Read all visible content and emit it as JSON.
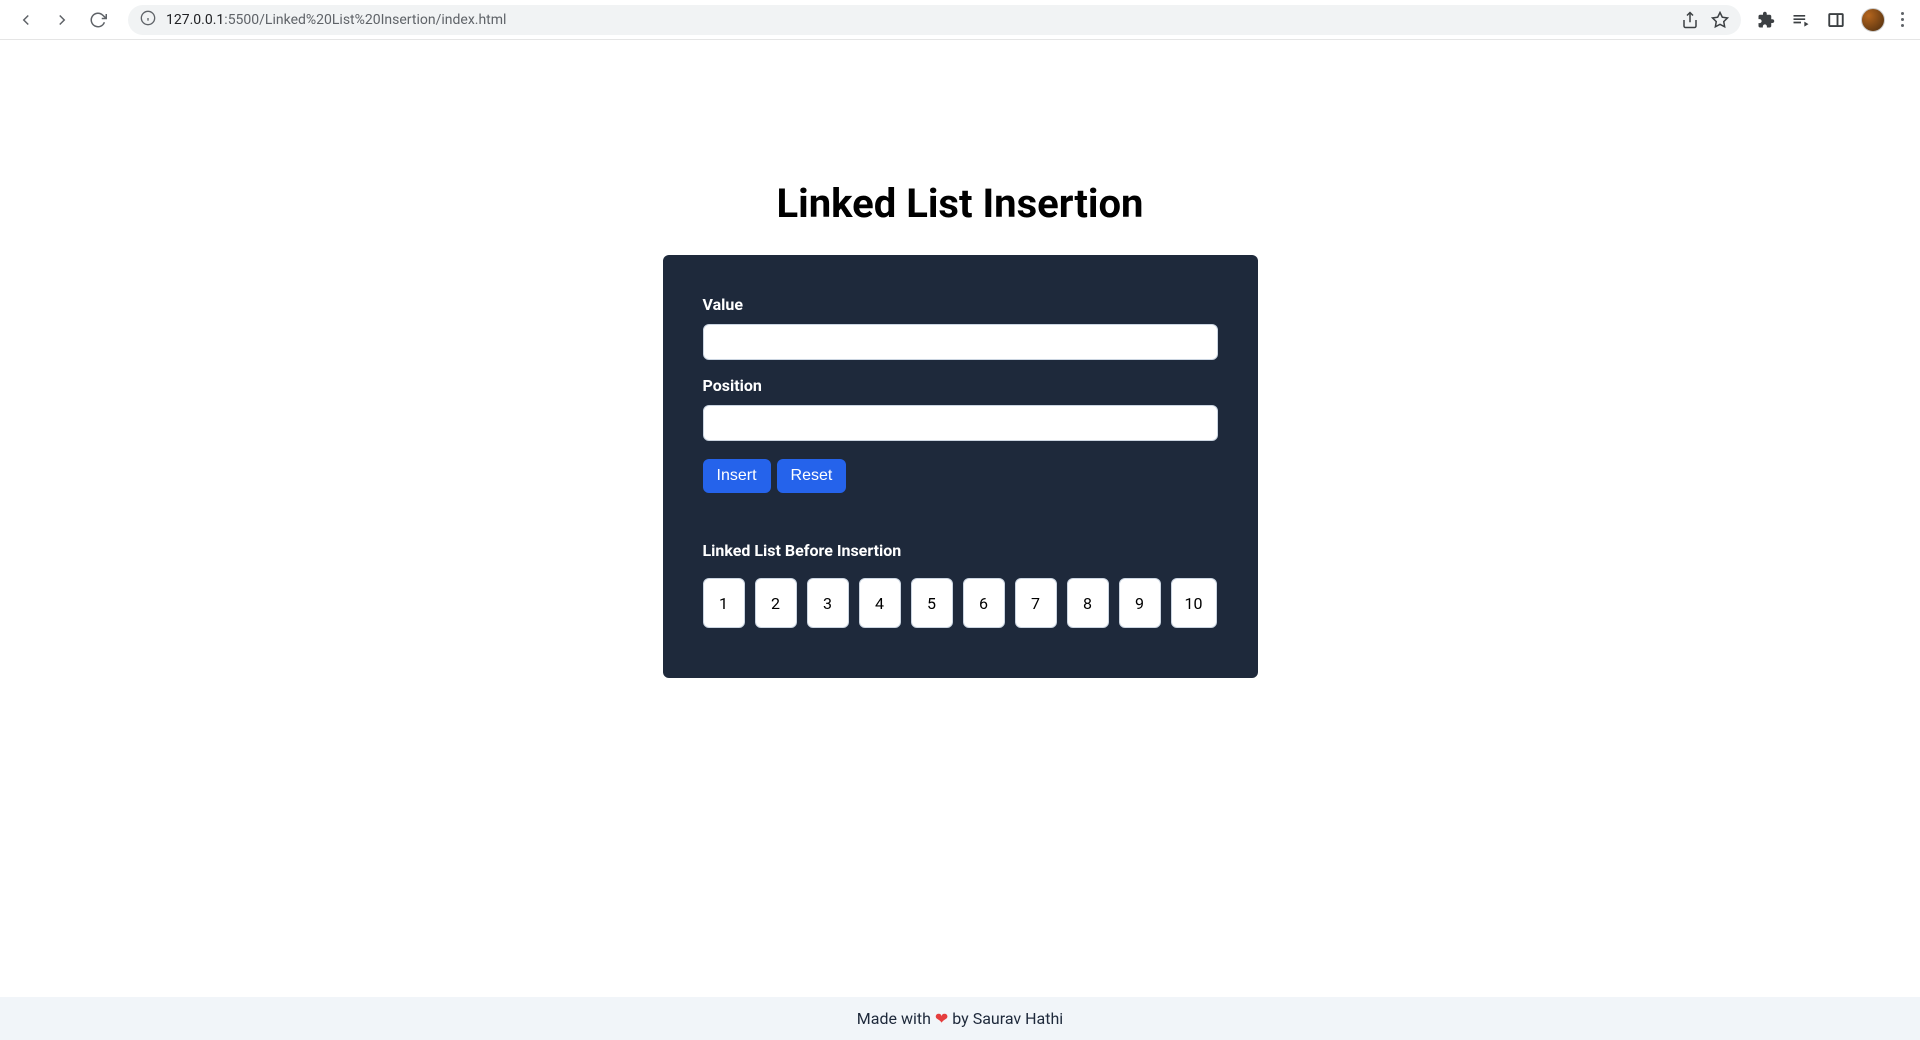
{
  "browser": {
    "url_host": "127.0.0.1",
    "url_port_path": ":5500/Linked%20List%20Insertion/index.html"
  },
  "page": {
    "title": "Linked List Insertion",
    "form": {
      "value_label": "Value",
      "value_input": "",
      "position_label": "Position",
      "position_input": "",
      "insert_button": "Insert",
      "reset_button": "Reset"
    },
    "list_section": {
      "heading": "Linked List Before Insertion",
      "nodes": [
        "1",
        "2",
        "3",
        "4",
        "5",
        "6",
        "7",
        "8",
        "9",
        "10"
      ]
    }
  },
  "footer": {
    "prefix": "Made with ",
    "heart": "❤",
    "suffix": " by Saurav Hathi"
  }
}
